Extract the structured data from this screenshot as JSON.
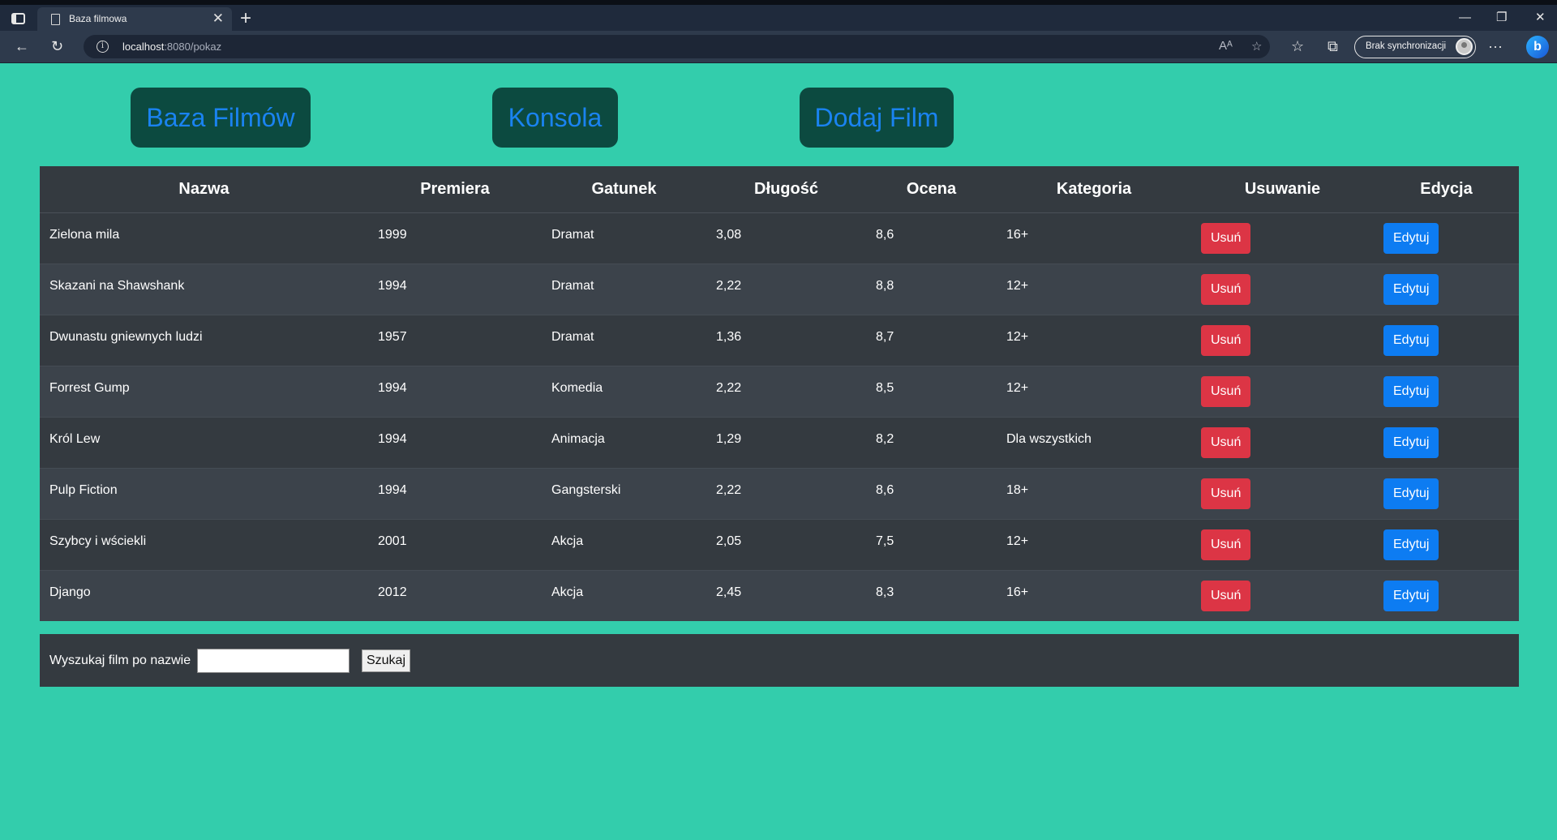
{
  "browser": {
    "tab_title": "Baza filmowa",
    "url_host": "localhost",
    "url_rest": ":8080/pokaz",
    "sync_label": "Brak synchronizacji"
  },
  "nav": {
    "home": "Baza Filmów",
    "console": "Konsola",
    "add": "Dodaj Film"
  },
  "table": {
    "headers": [
      "Nazwa",
      "Premiera",
      "Gatunek",
      "Długość",
      "Ocena",
      "Kategoria",
      "Usuwanie",
      "Edycja"
    ],
    "delete_label": "Usuń",
    "edit_label": "Edytuj",
    "rows": [
      [
        "Zielona mila",
        "1999",
        "Dramat",
        "3,08",
        "8,6",
        "16+"
      ],
      [
        "Skazani na Shawshank",
        "1994",
        "Dramat",
        "2,22",
        "8,8",
        "12+"
      ],
      [
        "Dwunastu gniewnych ludzi",
        "1957",
        "Dramat",
        "1,36",
        "8,7",
        "12+"
      ],
      [
        "Forrest Gump",
        "1994",
        "Komedia",
        "2,22",
        "8,5",
        "12+"
      ],
      [
        "Król Lew",
        "1994",
        "Animacja",
        "1,29",
        "8,2",
        "Dla wszystkich"
      ],
      [
        "Pulp Fiction",
        "1994",
        "Gangsterski",
        "2,22",
        "8,6",
        "18+"
      ],
      [
        "Szybcy i wściekli",
        "2001",
        "Akcja",
        "2,05",
        "7,5",
        "12+"
      ],
      [
        "Django",
        "2012",
        "Akcja",
        "2,45",
        "8,3",
        "16+"
      ]
    ]
  },
  "search": {
    "label": "Wyszukaj film po nazwie",
    "value": "",
    "button": "Szukaj"
  },
  "colors": {
    "page_bg": "#33cdac",
    "nav_bg": "#0c4a40",
    "nav_text": "#1a83f0",
    "delete": "#dc3545",
    "edit": "#0d7cf2"
  }
}
